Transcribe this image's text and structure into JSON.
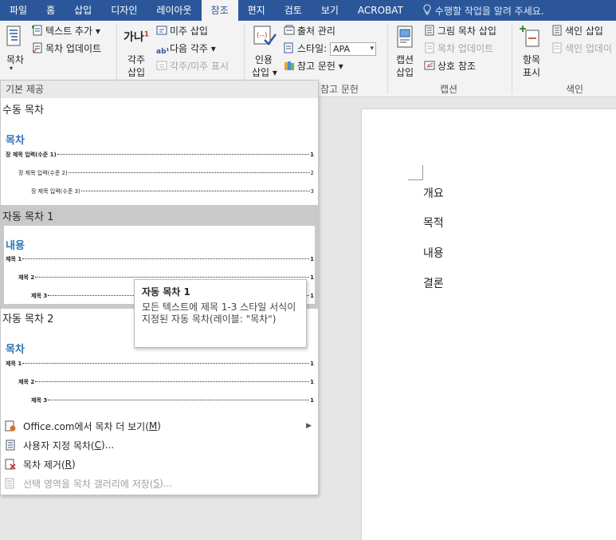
{
  "tabs": [
    "파일",
    "홈",
    "삽입",
    "디자인",
    "레이아웃",
    "참조",
    "편지",
    "검토",
    "보기",
    "ACROBAT"
  ],
  "active_tab": "참조",
  "tell_me": "수행할 작업을 알려 주세요.",
  "ribbon": {
    "toc_button": "목차",
    "add_text": "텍스트 추가",
    "update_toc": "목차 업데이트",
    "footnote_big": "각주\n삽입",
    "footnote_big_a": "각주",
    "footnote_big_b": "삽입",
    "insert_endnote": "미주 삽입",
    "next_footnote": "다음 각주",
    "show_notes": "각주/미주 표시",
    "citation_a": "인용",
    "citation_b": "삽입",
    "manage_sources": "출처 관리",
    "style_label": "스타일:",
    "style_value": "APA",
    "bibliography": "참고 문헌",
    "group_citations": "참고 문헌",
    "caption_a": "캡션",
    "caption_b": "삽입",
    "insert_tof": "그림 목차 삽입",
    "update_table": "목차 업데이트",
    "cross_ref": "상호 참조",
    "group_captions": "캡션",
    "mark_entry_a": "항목",
    "mark_entry_b": "표시",
    "insert_index": "색인 삽입",
    "update_index": "색인 업데이",
    "group_index": "색인"
  },
  "document": {
    "lines": [
      "개요",
      "목적",
      "내용",
      "결론"
    ]
  },
  "gallery": {
    "header": "기본 제공",
    "manual": {
      "title": "수동 목차",
      "heading": "목차",
      "entries": [
        "장 제목 입력(수준 1)",
        "장 제목 입력(수준 2)",
        "장 제목 입력(수준 3)"
      ],
      "pages": [
        "1",
        "2",
        "3"
      ]
    },
    "auto1": {
      "title": "자동 목차 1",
      "heading": "내용",
      "entries": [
        "제목 1",
        "제목 2",
        "제목 3"
      ],
      "pages": [
        "1",
        "1",
        "1"
      ]
    },
    "auto2": {
      "title": "자동 목차 2",
      "heading": "목차",
      "entries": [
        "제목 1",
        "제목 2",
        "제목 3"
      ],
      "pages": [
        "1",
        "1",
        "1"
      ]
    },
    "menu": {
      "more_office_pre": "Office.com에서 목차 더 보기(",
      "more_office_key": "M",
      "custom_pre": "사용자 지정 목차(",
      "custom_key": "C",
      "custom_post": ")...",
      "remove_pre": "목차 제거(",
      "remove_key": "R",
      "save_pre": "선택 영역을 목차 갤러리에 저장(",
      "save_key": "S",
      "save_post": ")...",
      "close_paren": ")"
    }
  },
  "tooltip": {
    "title": "자동 목차 1",
    "body": "모든 텍스트에 제목 1-3 스타일 서식이 지정된 자동 목차(레이블: \"목차\")"
  },
  "colors": {
    "brand": "#2b579a",
    "heading_blue": "#2e74b5",
    "highlight": "#c9c9c9"
  }
}
